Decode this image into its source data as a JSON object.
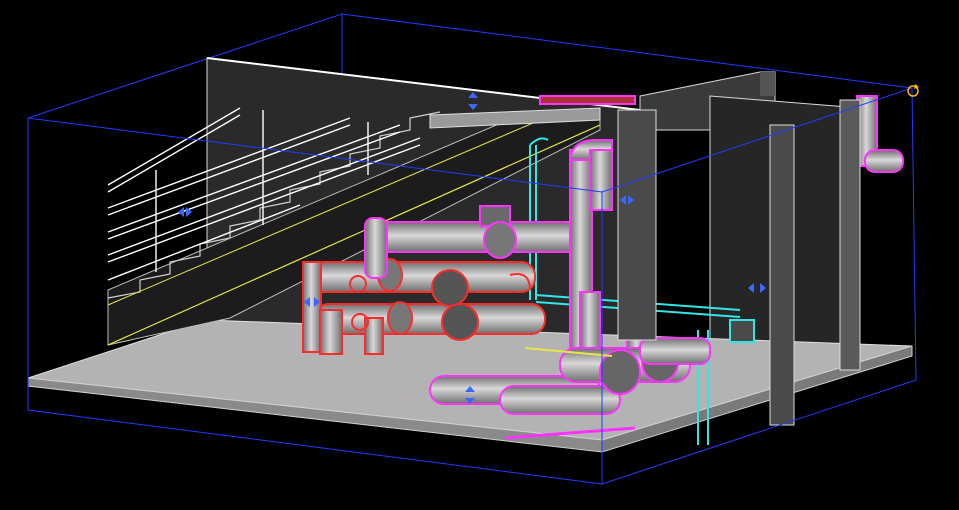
{
  "viewport": {
    "background": "#000000",
    "section_box_color": "#1e3cff",
    "wall_color": "#2b2b2b",
    "wall_edge_color": "#dcdcdc",
    "floor_color": "#b4b4b4",
    "stair_line_color": "#e6e64a",
    "handrail_color": "#ffffff"
  },
  "systems": [
    {
      "name": "fire-protection-pipe",
      "color": "#ff2a2a"
    },
    {
      "name": "domestic-water-pipe",
      "color": "#ff33ff"
    },
    {
      "name": "cold-water-pipe",
      "color": "#33e6e6"
    }
  ],
  "controls": {
    "rotate_icon": "rotate-icon",
    "section_grip_icon": "section-grip-icon"
  }
}
